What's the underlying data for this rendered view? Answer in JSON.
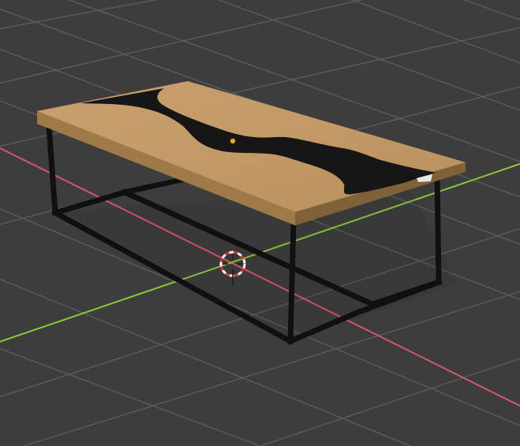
{
  "viewport": {
    "mode": "3d-viewport",
    "background_color": "#3d3d3d",
    "grid_color": "#5c5c5c",
    "x_axis_color": "#d9566a",
    "y_axis_color": "#88c93a"
  },
  "scene": {
    "object": "coffee-table",
    "tabletop_wood_color": "#c39a66",
    "resin_river_color": "#161616",
    "leg_frame_color": "#101010",
    "origin_point_color": "#f0a030",
    "cursor_icon": "3d-cursor-icon"
  }
}
